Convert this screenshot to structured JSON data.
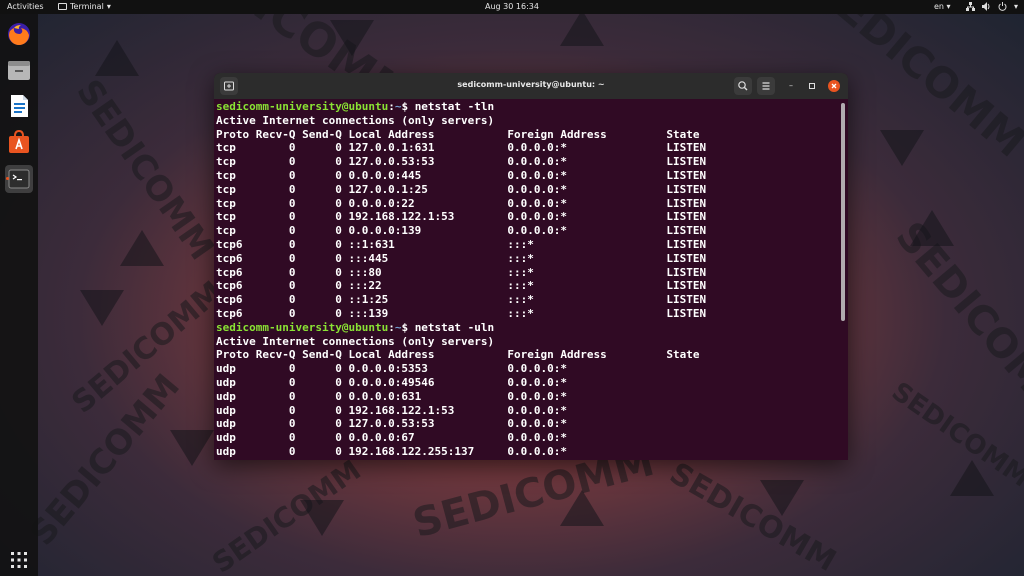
{
  "topbar": {
    "activities": "Activities",
    "app_name": "Terminal",
    "clock": "Aug 30  16:34",
    "lang": "en"
  },
  "watermark": {
    "text": "SEDICOMM"
  },
  "dock": {
    "items": [
      "firefox-icon",
      "files-icon",
      "writer-icon",
      "software-icon",
      "terminal-icon",
      "show-apps-icon"
    ]
  },
  "window": {
    "title": "sedicomm-university@ubuntu: ~"
  },
  "terminal": {
    "prompt_user": "sedicomm-university@ubuntu",
    "prompt_path": "~",
    "cmd1": "netstat -tln",
    "cmd2": "netstat -uln",
    "active_header": "Active Internet connections (only servers)",
    "col_header": "Proto Recv-Q Send-Q Local Address           Foreign Address         State",
    "tcp_rows": [
      "tcp        0      0 127.0.0.1:631           0.0.0.0:*               LISTEN",
      "tcp        0      0 127.0.0.53:53           0.0.0.0:*               LISTEN",
      "tcp        0      0 0.0.0.0:445             0.0.0.0:*               LISTEN",
      "tcp        0      0 127.0.0.1:25            0.0.0.0:*               LISTEN",
      "tcp        0      0 0.0.0.0:22              0.0.0.0:*               LISTEN",
      "tcp        0      0 192.168.122.1:53        0.0.0.0:*               LISTEN",
      "tcp        0      0 0.0.0.0:139             0.0.0.0:*               LISTEN",
      "tcp6       0      0 ::1:631                 :::*                    LISTEN",
      "tcp6       0      0 :::445                  :::*                    LISTEN",
      "tcp6       0      0 :::80                   :::*                    LISTEN",
      "tcp6       0      0 :::22                   :::*                    LISTEN",
      "tcp6       0      0 ::1:25                  :::*                    LISTEN",
      "tcp6       0      0 :::139                  :::*                    LISTEN"
    ],
    "udp_rows": [
      "udp        0      0 0.0.0.0:5353            0.0.0.0:*",
      "udp        0      0 0.0.0.0:49546           0.0.0.0:*",
      "udp        0      0 0.0.0.0:631             0.0.0.0:*",
      "udp        0      0 192.168.122.1:53        0.0.0.0:*",
      "udp        0      0 127.0.0.53:53           0.0.0.0:*",
      "udp        0      0 0.0.0.0:67              0.0.0.0:*",
      "udp        0      0 192.168.122.255:137     0.0.0.0:*"
    ]
  },
  "colors": {
    "terminal_bg": "#300a24",
    "prompt_user": "#8ae234",
    "prompt_path": "#729fcf",
    "accent": "#e95420"
  }
}
